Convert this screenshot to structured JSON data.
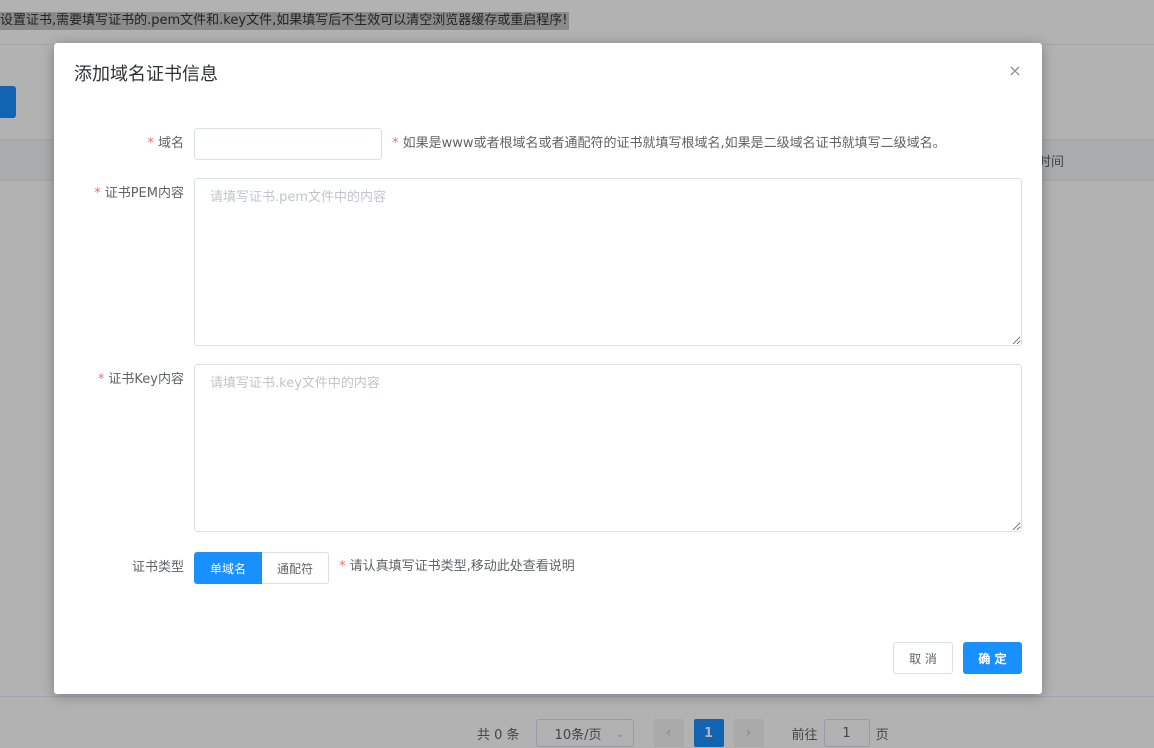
{
  "background": {
    "notice_text": "设置证书,需要填写证书的.pem文件和.key文件,如果填写后不生效可以清空浏览器缓存或重启程序!",
    "table_header_time": "时间",
    "pagination": {
      "total": "共 0 条",
      "page_size": "10条/页",
      "prev_icon": "‹",
      "current_page": "1",
      "next_icon": "›",
      "goto_label": "前往",
      "goto_value": "1",
      "page_suffix": "页"
    }
  },
  "dialog": {
    "title": "添加域名证书信息",
    "close_icon": "×",
    "domain": {
      "label": "域名",
      "required_mark": "*",
      "value": "",
      "hint": "* 如果是www或者根域名或者通配符的证书就填写根域名,如果是二级域名证书就填写二级域名。"
    },
    "pem": {
      "label": "证书PEM内容",
      "required_mark": "*",
      "placeholder": "请填写证书.pem文件中的内容"
    },
    "key": {
      "label": "证书Key内容",
      "required_mark": "*",
      "placeholder": "请填写证书.key文件中的内容"
    },
    "cert_type": {
      "label": "证书类型",
      "options": [
        "单域名",
        "通配符"
      ],
      "selected": "单域名",
      "hint": "* 请认真填写证书类型,移动此处查看说明"
    },
    "buttons": {
      "cancel": "取 消",
      "confirm": "确 定"
    }
  },
  "colors": {
    "primary": "#1890ff",
    "required": "#f56c6c",
    "overlay": "rgba(0,0,0,0.30)"
  }
}
